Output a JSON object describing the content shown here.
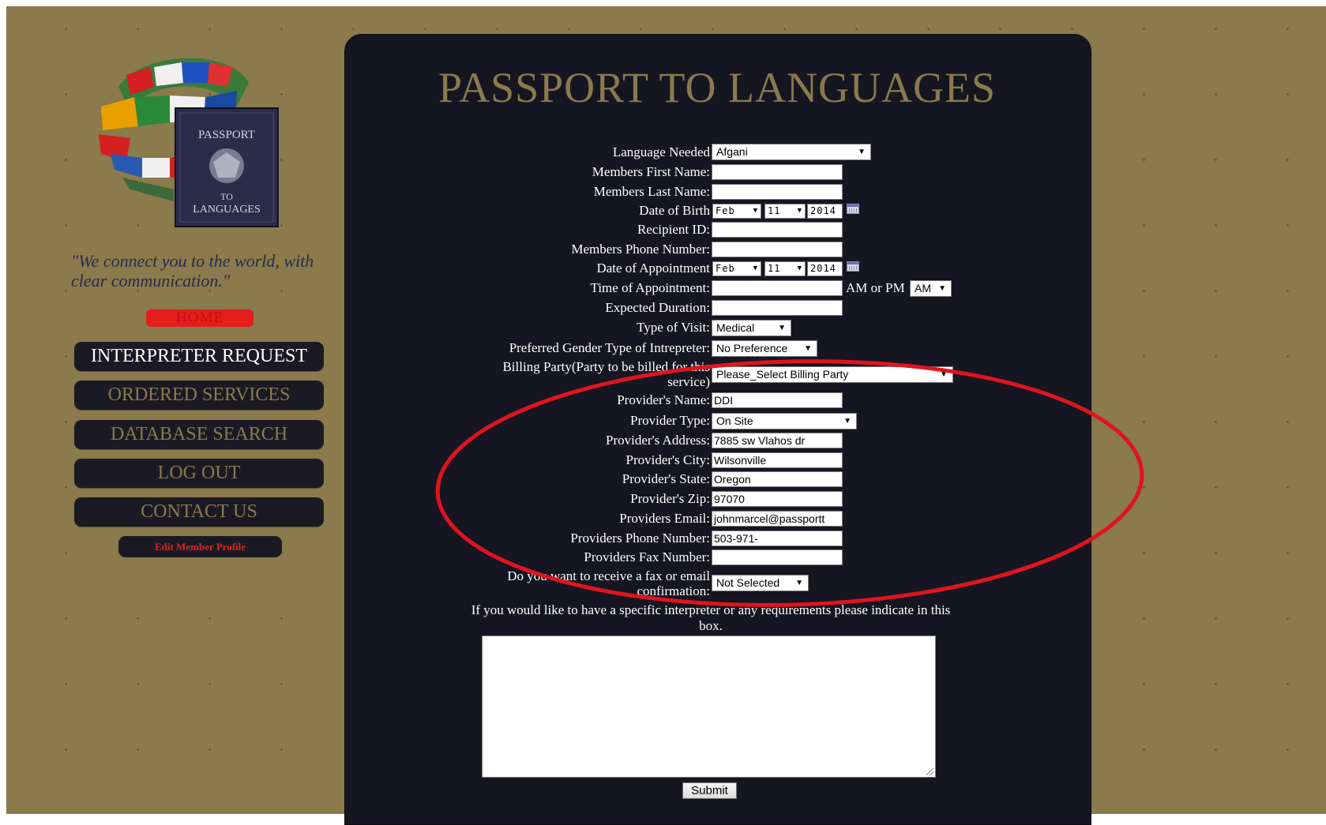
{
  "site": {
    "title": "PASSPORT TO LANGUAGES",
    "tagline": "\"We connect you to the world, with clear communication.\"",
    "logo_text": [
      "PASSPORT",
      "TO",
      "LANGUAGES"
    ]
  },
  "nav": {
    "home": "HOME",
    "items": [
      {
        "label": "INTERPRETER REQUEST",
        "active": true
      },
      {
        "label": "ORDERED SERVICES",
        "active": false
      },
      {
        "label": "DATABASE SEARCH",
        "active": false
      },
      {
        "label": "LOG OUT",
        "active": false
      },
      {
        "label": "CONTACT US",
        "active": false
      }
    ],
    "edit_profile": "Edit Member Profile"
  },
  "form": {
    "language": {
      "label": "Language Needed",
      "value": "Afgani"
    },
    "first_name": {
      "label": "Members First Name:",
      "value": ""
    },
    "last_name": {
      "label": "Members Last Name:",
      "value": ""
    },
    "dob": {
      "label": "Date of Birth",
      "month": "Feb",
      "day": "11",
      "year": "2014"
    },
    "recipient_id": {
      "label": "Recipient ID:",
      "value": ""
    },
    "phone": {
      "label": "Members Phone Number:",
      "value": ""
    },
    "appt_date": {
      "label": "Date of Appointment",
      "month": "Feb",
      "day": "11",
      "year": "2014"
    },
    "appt_time": {
      "label": "Time of Appointment:",
      "value": "",
      "ampm_label": "AM or PM",
      "ampm": "AM"
    },
    "duration": {
      "label": "Expected Duration:",
      "value": ""
    },
    "visit_type": {
      "label": "Type of Visit:",
      "value": "Medical"
    },
    "gender_pref": {
      "label": "Preferred Gender Type of Intrepreter:",
      "value": "No Preference"
    },
    "billing": {
      "label_line1": "Billing Party(Party to be billed for this",
      "label_line2": "service)",
      "value": "Please_Select Billing Party"
    },
    "provider_name": {
      "label": "Provider's Name:",
      "value": "DDI"
    },
    "provider_type": {
      "label": "Provider Type:",
      "value": "On Site"
    },
    "provider_address": {
      "label": "Provider's Address:",
      "value": "7885 sw Vlahos dr"
    },
    "provider_city": {
      "label": "Provider's City:",
      "value": "Wilsonville"
    },
    "provider_state": {
      "label": "Provider's State:",
      "value": "Oregon"
    },
    "provider_zip": {
      "label": "Provider's Zip:",
      "value": "97070"
    },
    "provider_email": {
      "label": "Providers Email:",
      "value": "johnmarcel@passportt"
    },
    "provider_phone": {
      "label": "Providers Phone Number:",
      "value": "503-971-"
    },
    "provider_fax": {
      "label": "Providers Fax Number:",
      "value": ""
    },
    "confirmation": {
      "label_line1": "Do you want to receive a fax or email",
      "label_line2": "confirmation:",
      "value": "Not Selected"
    },
    "specific_note": "If you would like to have a specific interpreter or any requirements please indicate in this box.",
    "notes_value": "",
    "submit": "Submit"
  },
  "colors": {
    "background": "#8a7a4c",
    "panel": "#161622",
    "title_gold": "#8a7a4c",
    "home_red": "#e51d1d",
    "highlight_ellipse": "#e0141e"
  },
  "icons": {
    "calendar": "calendar-icon",
    "dropdown": "chevron-down-icon"
  }
}
